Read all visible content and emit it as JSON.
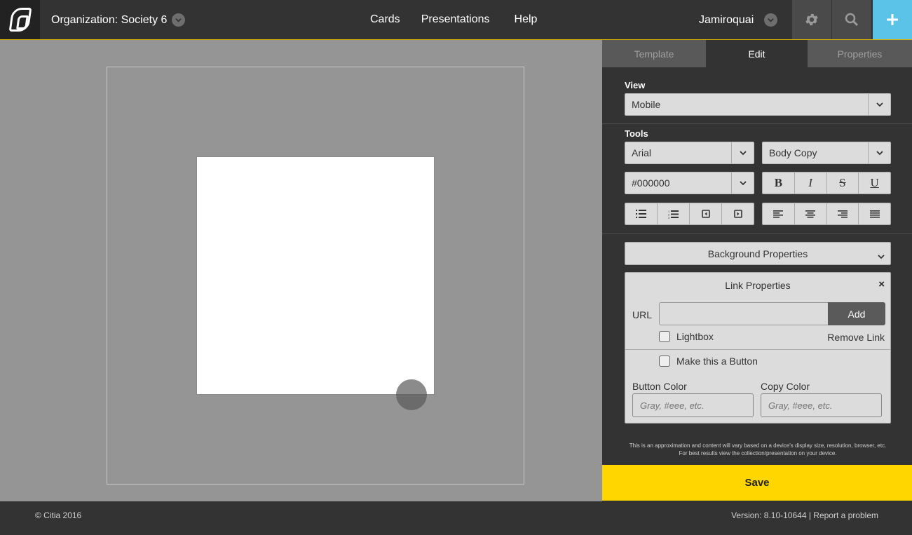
{
  "header": {
    "org_label": "Organization: Society 6",
    "nav": [
      "Cards",
      "Presentations",
      "Help"
    ],
    "user": "Jamiroquai"
  },
  "panel": {
    "tabs": [
      "Template",
      "Edit",
      "Properties"
    ],
    "active_tab": "Edit",
    "view_label": "View",
    "view_value": "Mobile",
    "tools_label": "Tools",
    "font_value": "Arial",
    "style_value": "Body Copy",
    "color_value": "#000000",
    "format_buttons": [
      "B",
      "I",
      "S",
      "U"
    ],
    "background_properties": "Background Properties",
    "link": {
      "title": "Link Properties",
      "close": "×",
      "url_label": "URL",
      "url_value": "",
      "add_label": "Add",
      "lightbox_label": "Lightbox",
      "remove_label": "Remove Link",
      "make_button_label": "Make this a Button",
      "button_color_label": "Button Color",
      "copy_color_label": "Copy Color",
      "button_color_placeholder": "Gray, #eee, etc.",
      "copy_color_placeholder": "Gray, #eee, etc."
    },
    "disclaimer": "This is an approximation and content will vary based on a device's display size, resolution, browser, etc. For best results view the collection/presentation on your device.",
    "save_label": "Save"
  },
  "footer": {
    "copyright": "© Citia 2016",
    "version": "Version: 8.10-10644 | Report a problem"
  },
  "colors": {
    "accent_yellow": "#ffd600",
    "accent_blue": "#5bc3e8",
    "dark": "#333333"
  }
}
